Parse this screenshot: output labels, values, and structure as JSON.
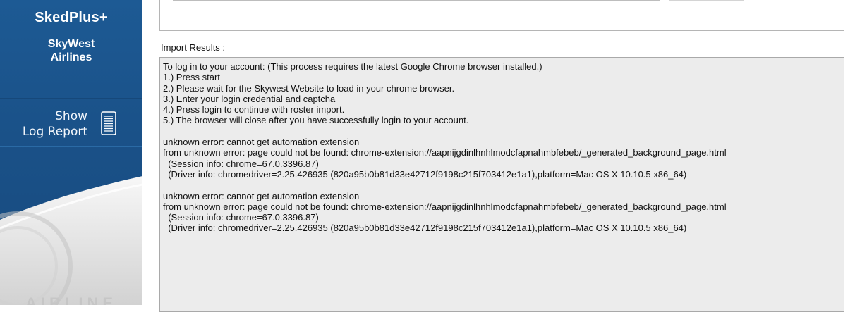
{
  "sidebar": {
    "app_title": "SkedPlus+",
    "airline_line1": "SkyWest",
    "airline_line2": "Airlines",
    "log_report": {
      "line1": "Show",
      "line2": "Log Report",
      "icon": "document-list-icon"
    },
    "watermark": "AIRLINE",
    "colors": {
      "background": "#1b5489",
      "accent_swoosh": "#e6e6e6"
    }
  },
  "main": {
    "results_label": "Import Results :",
    "results_text": "To log in to your account: (This process requires the latest Google Chrome browser installed.)\n1.) Press start\n2.) Please wait for the Skywest Website to load in your chrome browser.\n3.) Enter your login credential and captcha\n4.) Press login to continue with roster import.\n5.) The browser will close after you have successfully login to your account.\n\nunknown error: cannot get automation extension\nfrom unknown error: page could not be found: chrome-extension://aapnijgdinlhnhlmodcfapnahmbfebeb/_generated_background_page.html\n  (Session info: chrome=67.0.3396.87)\n  (Driver info: chromedriver=2.25.426935 (820a95b0b81d33e42712f9198c215f703412e1a1),platform=Mac OS X 10.10.5 x86_64)\n\nunknown error: cannot get automation extension\nfrom unknown error: page could not be found: chrome-extension://aapnijgdinlhnhlmodcfapnahmbfebeb/_generated_background_page.html\n  (Session info: chrome=67.0.3396.87)\n  (Driver info: chromedriver=2.25.426935 (820a95b0b81d33e42712f9198c215f703412e1a1),platform=Mac OS X 10.10.5 x86_64)"
  }
}
